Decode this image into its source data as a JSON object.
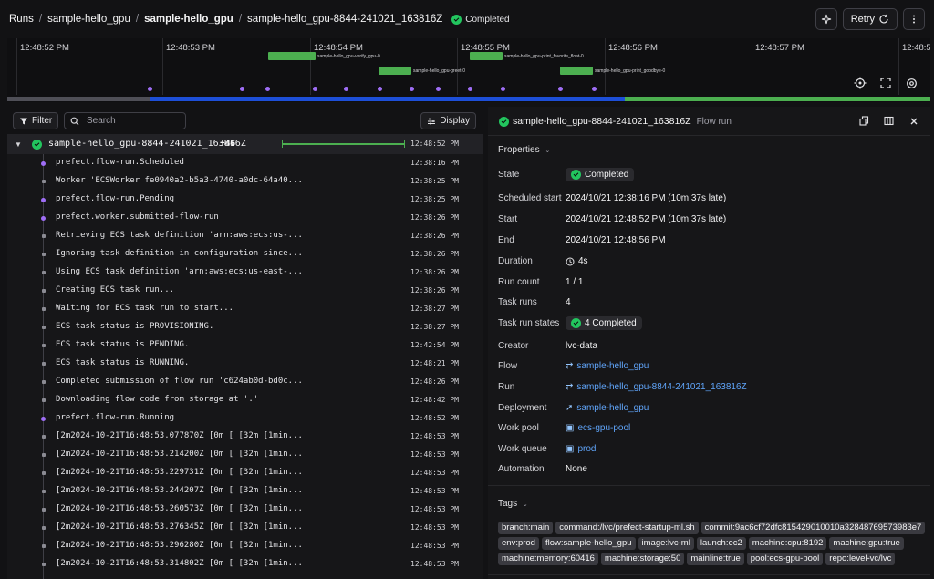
{
  "breadcrumb": {
    "root": "Runs",
    "flow": "sample-hello_gpu",
    "deployment": "sample-hello_gpu",
    "run": "sample-hello_gpu-8844-241021_163816Z",
    "status": "Completed"
  },
  "header": {
    "retry_label": "Retry",
    "more_icon": "more-vertical-icon",
    "sparkle_icon": "sparkle-icon"
  },
  "timeline": {
    "ticks": [
      "12:48:52 PM",
      "12:48:53 PM",
      "12:48:54 PM",
      "12:48:55 PM",
      "12:48:56 PM",
      "12:48:57 PM",
      "12:48:5"
    ],
    "task_labels": [
      "sample-hello_gpu-verify_gpu-0",
      "sample-hello_gpu-greet-0",
      "sample-hello_gpu-print_favorite_float-0",
      "sample-hello_gpu-print_goodbye-0"
    ],
    "colors": {
      "pending": "#4f4f57",
      "running": "#1d4fd8",
      "completed": "#4caf50",
      "event": "#9f6ef6"
    }
  },
  "toolbar": {
    "filter_label": "Filter",
    "search_placeholder": "Search",
    "display_label": "Display"
  },
  "root_run": {
    "name": "sample-hello_gpu-8844-241021_163816Z",
    "count": "+46",
    "time": "12:48:52 PM"
  },
  "logs": [
    {
      "msg": "prefect.flow-run.Scheduled",
      "time": "12:38:16 PM",
      "kind": "event"
    },
    {
      "msg": "Worker 'ECSWorker fe0940a2-b5a3-4740-a0dc-64a40...",
      "time": "12:38:25 PM",
      "kind": "log"
    },
    {
      "msg": "prefect.flow-run.Pending",
      "time": "12:38:25 PM",
      "kind": "event"
    },
    {
      "msg": "prefect.worker.submitted-flow-run",
      "time": "12:38:26 PM",
      "kind": "event"
    },
    {
      "msg": "Retrieving ECS task definition 'arn:aws:ecs:us-...",
      "time": "12:38:26 PM",
      "kind": "log"
    },
    {
      "msg": "Ignoring task definition in configuration since...",
      "time": "12:38:26 PM",
      "kind": "log"
    },
    {
      "msg": "Using ECS task definition 'arn:aws:ecs:us-east-...",
      "time": "12:38:26 PM",
      "kind": "log"
    },
    {
      "msg": "Creating ECS task run...",
      "time": "12:38:26 PM",
      "kind": "log"
    },
    {
      "msg": "Waiting for ECS task run to start...",
      "time": "12:38:27 PM",
      "kind": "log"
    },
    {
      "msg": "ECS task status is PROVISIONING.",
      "time": "12:38:27 PM",
      "kind": "log"
    },
    {
      "msg": "ECS task status is PENDING.",
      "time": "12:42:54 PM",
      "kind": "log"
    },
    {
      "msg": "ECS task status is RUNNING.",
      "time": "12:48:21 PM",
      "kind": "log"
    },
    {
      "msg": "Completed submission of flow run 'c624ab0d-bd0c...",
      "time": "12:48:26 PM",
      "kind": "log"
    },
    {
      "msg": "Downloading flow code from storage at '.'",
      "time": "12:48:42 PM",
      "kind": "log"
    },
    {
      "msg": "prefect.flow-run.Running",
      "time": "12:48:52 PM",
      "kind": "event"
    },
    {
      "msg": "[2m2024-10-21T16:48:53.077870Z [0m [ [32m [1min...",
      "time": "12:48:53 PM",
      "kind": "log"
    },
    {
      "msg": "[2m2024-10-21T16:48:53.214200Z [0m [ [32m [1min...",
      "time": "12:48:53 PM",
      "kind": "log"
    },
    {
      "msg": "[2m2024-10-21T16:48:53.229731Z [0m [ [32m [1min...",
      "time": "12:48:53 PM",
      "kind": "log"
    },
    {
      "msg": "[2m2024-10-21T16:48:53.244207Z [0m [ [32m [1min...",
      "time": "12:48:53 PM",
      "kind": "log"
    },
    {
      "msg": "[2m2024-10-21T16:48:53.260573Z [0m [ [32m [1min...",
      "time": "12:48:53 PM",
      "kind": "log"
    },
    {
      "msg": "[2m2024-10-21T16:48:53.276345Z [0m [ [32m [1min...",
      "time": "12:48:53 PM",
      "kind": "log"
    },
    {
      "msg": "[2m2024-10-21T16:48:53.296280Z [0m [ [32m [1min...",
      "time": "12:48:53 PM",
      "kind": "log"
    },
    {
      "msg": "[2m2024-10-21T16:48:53.314802Z [0m [ [32m [1min...",
      "time": "12:48:53 PM",
      "kind": "log"
    }
  ],
  "panel": {
    "title": "sample-hello_gpu-8844-241021_163816Z",
    "subtitle": "Flow run",
    "properties_label": "Properties",
    "tags_label": "Tags",
    "props": {
      "state_k": "State",
      "state_v": "Completed",
      "sched_k": "Scheduled start",
      "sched_v": "2024/10/21 12:38:16 PM (10m 37s late)",
      "start_k": "Start",
      "start_v": "2024/10/21 12:48:52 PM (10m 37s late)",
      "end_k": "End",
      "end_v": "2024/10/21 12:48:56 PM",
      "duration_k": "Duration",
      "duration_v": "4s",
      "runcount_k": "Run count",
      "runcount_v": "1 / 1",
      "taskruns_k": "Task runs",
      "taskruns_v": "4",
      "taskstates_k": "Task run states",
      "taskstates_v": "4 Completed",
      "creator_k": "Creator",
      "creator_v": "lvc-data",
      "flow_k": "Flow",
      "flow_v": "sample-hello_gpu",
      "run_k": "Run",
      "run_v": "sample-hello_gpu-8844-241021_163816Z",
      "deployment_k": "Deployment",
      "deployment_v": "sample-hello_gpu",
      "workpool_k": "Work pool",
      "workpool_v": "ecs-gpu-pool",
      "workqueue_k": "Work queue",
      "workqueue_v": "prod",
      "automation_k": "Automation",
      "automation_v": "None"
    },
    "tags": [
      "branch:main",
      "command:/lvc/prefect-startup-ml.sh",
      "commit:9ac6cf72dfc815429010010a32848769573983e7",
      "env:prod",
      "flow:sample-hello_gpu",
      "image:lvc-ml",
      "launch:ec2",
      "machine:cpu:8192",
      "machine:gpu:true",
      "machine:memory:60416",
      "machine:storage:50",
      "mainline:true",
      "pool:ecs-gpu-pool",
      "repo:level-vc/lvc"
    ]
  }
}
